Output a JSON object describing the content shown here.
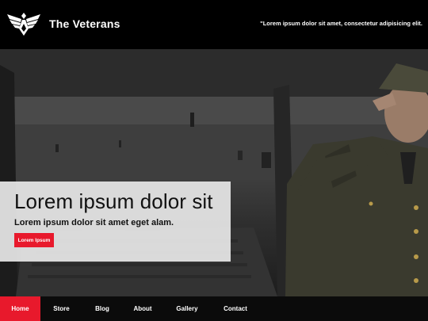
{
  "header": {
    "title": "The Veterans",
    "tagline": "\"Lorem ipsum dolor sit amet, consectetur adipisicing elit."
  },
  "hero": {
    "heading": "Lorem ipsum dolor sit",
    "subheading": "Lorem ipsum dolor sit amet eget alam.",
    "button_label": "Lorem Ipsum"
  },
  "nav": {
    "items": [
      {
        "label": "Home",
        "active": true
      },
      {
        "label": "Store",
        "active": false
      },
      {
        "label": "Blog",
        "active": false
      },
      {
        "label": "About",
        "active": false
      },
      {
        "label": "Gallery",
        "active": false
      },
      {
        "label": "Contact",
        "active": false
      }
    ]
  },
  "colors": {
    "accent": "#e8192c",
    "header_bg": "#000000",
    "card_bg": "#e4e4e4"
  },
  "icons": {
    "logo": "eagle-emblem-icon"
  }
}
